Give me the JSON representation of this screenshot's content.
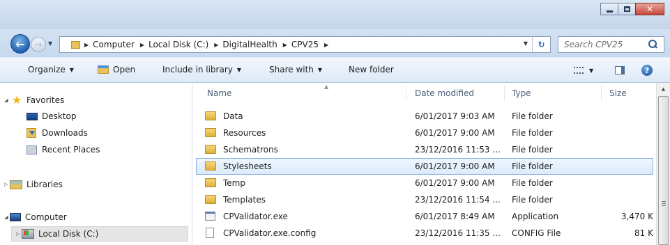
{
  "window": {
    "minimize_icon": "minimize-icon",
    "maximize_icon": "maximize-icon",
    "close_symbol": "✕"
  },
  "address": {
    "breadcrumb": [
      "Computer",
      "Local Disk (C:)",
      "DigitalHealth",
      "CPV25"
    ]
  },
  "search": {
    "placeholder": "Search CPV25"
  },
  "toolbar": {
    "organize": "Organize",
    "open": "Open",
    "include_in_library": "Include in library",
    "share_with": "Share with",
    "new_folder": "New folder"
  },
  "nav": {
    "favorites": "Favorites",
    "desktop": "Desktop",
    "downloads": "Downloads",
    "recent_places": "Recent Places",
    "libraries": "Libraries",
    "computer": "Computer",
    "local_disk": "Local Disk (C:)"
  },
  "columns": {
    "name": "Name",
    "date_modified": "Date modified",
    "type": "Type",
    "size": "Size"
  },
  "files": [
    {
      "name": "Data",
      "date": "6/01/2017 9:03 AM",
      "type": "File folder",
      "size": "",
      "icon": "folder"
    },
    {
      "name": "Resources",
      "date": "6/01/2017 9:00 AM",
      "type": "File folder",
      "size": "",
      "icon": "folder"
    },
    {
      "name": "Schematrons",
      "date": "23/12/2016 11:53 ...",
      "type": "File folder",
      "size": "",
      "icon": "folder"
    },
    {
      "name": "Stylesheets",
      "date": "6/01/2017 9:00 AM",
      "type": "File folder",
      "size": "",
      "icon": "folder"
    },
    {
      "name": "Temp",
      "date": "6/01/2017 9:00 AM",
      "type": "File folder",
      "size": "",
      "icon": "folder"
    },
    {
      "name": "Templates",
      "date": "23/12/2016 11:54 ...",
      "type": "File folder",
      "size": "",
      "icon": "folder"
    },
    {
      "name": "CPValidator.exe",
      "date": "6/01/2017 8:49 AM",
      "type": "Application",
      "size": "3,470 K",
      "icon": "application"
    },
    {
      "name": "CPValidator.exe.config",
      "date": "23/12/2016 11:35 ...",
      "type": "CONFIG File",
      "size": "81 K",
      "icon": "config"
    }
  ],
  "selected_file": "Stylesheets",
  "colors": {
    "selection_border": "#84acdd",
    "selection_fill": "#dcebfb",
    "titlebar": "#c4d6ec"
  }
}
